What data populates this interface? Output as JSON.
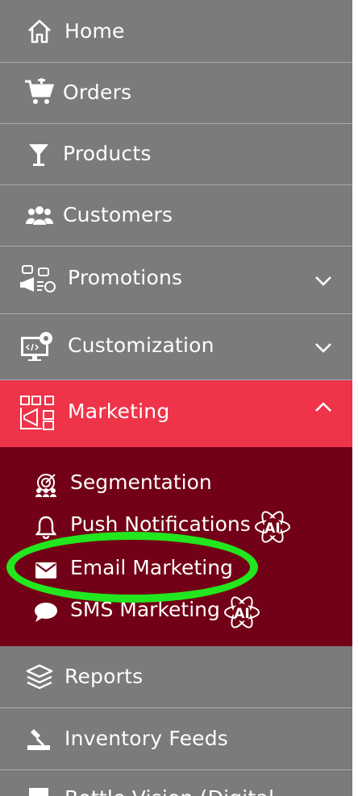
{
  "nav": {
    "home": "Home",
    "orders": "Orders",
    "products": "Products",
    "customers": "Customers",
    "promotions": "Promotions",
    "customization": "Customization",
    "marketing": "Marketing",
    "reports": "Reports",
    "inventory_feeds": "Inventory Feeds",
    "partial_bottom": "Bottle Vision (Digital"
  },
  "marketing_submenu": {
    "segmentation": "Segmentation",
    "push_notifications": "Push Notifications",
    "email_marketing": "Email Marketing",
    "sms_marketing": "SMS Marketing",
    "ai_badge": "AI"
  },
  "colors": {
    "sidebar_bg": "#7b7b7b",
    "active_bg": "#ef3349",
    "submenu_bg": "#720016",
    "highlight": "#22e61e"
  }
}
